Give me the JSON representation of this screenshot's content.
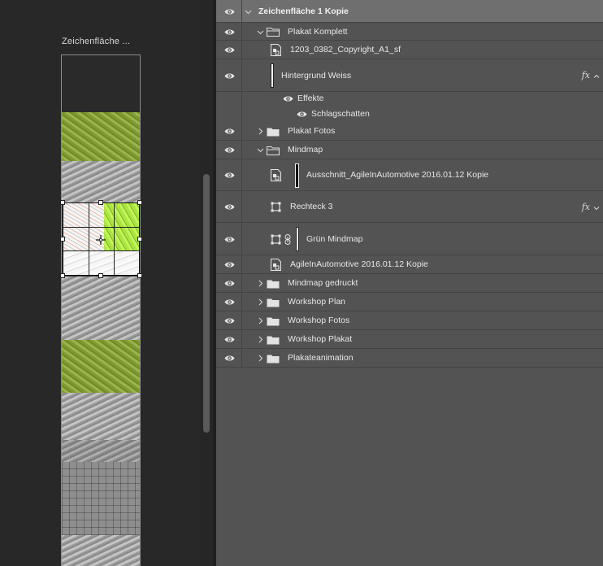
{
  "canvas": {
    "artboard_label": "Zeichenfläche ..."
  },
  "icons": {
    "eye": "eye-icon",
    "chevron_right": "chevron-right-icon",
    "chevron_down": "chevron-down-icon",
    "folder": "folder-icon",
    "smart_object": "smart-object-icon",
    "shape": "shape-layer-icon",
    "link": "link-icon",
    "fx": "fx-icon",
    "move_cursor": "move-cursor-icon"
  },
  "layers": {
    "rows": [
      {
        "label": "Zeichenfläche 1 Kopie"
      },
      {
        "label": "Plakat Komplett"
      },
      {
        "label": "1203_0382_Copyright_A1_sf"
      },
      {
        "label": "Hintergrund Weiss",
        "fx": "fx"
      },
      {
        "label": "Effekte"
      },
      {
        "label": "Schlagschatten"
      },
      {
        "label": "Plakat Fotos"
      },
      {
        "label": "Mindmap"
      },
      {
        "label": "Ausschnitt_AgileInAutomotive 2016.01.12 Kopie"
      },
      {
        "label": "Rechteck 3",
        "fx": "fx"
      },
      {
        "label": "Grün Mindmap"
      },
      {
        "label": "AgileInAutomotive 2016.01.12 Kopie"
      },
      {
        "label": "Mindmap gedruckt"
      },
      {
        "label": "Workshop Plan"
      },
      {
        "label": "Workshop Fotos"
      },
      {
        "label": "Workshop Plakat"
      },
      {
        "label": "Plakateanimation"
      }
    ]
  }
}
